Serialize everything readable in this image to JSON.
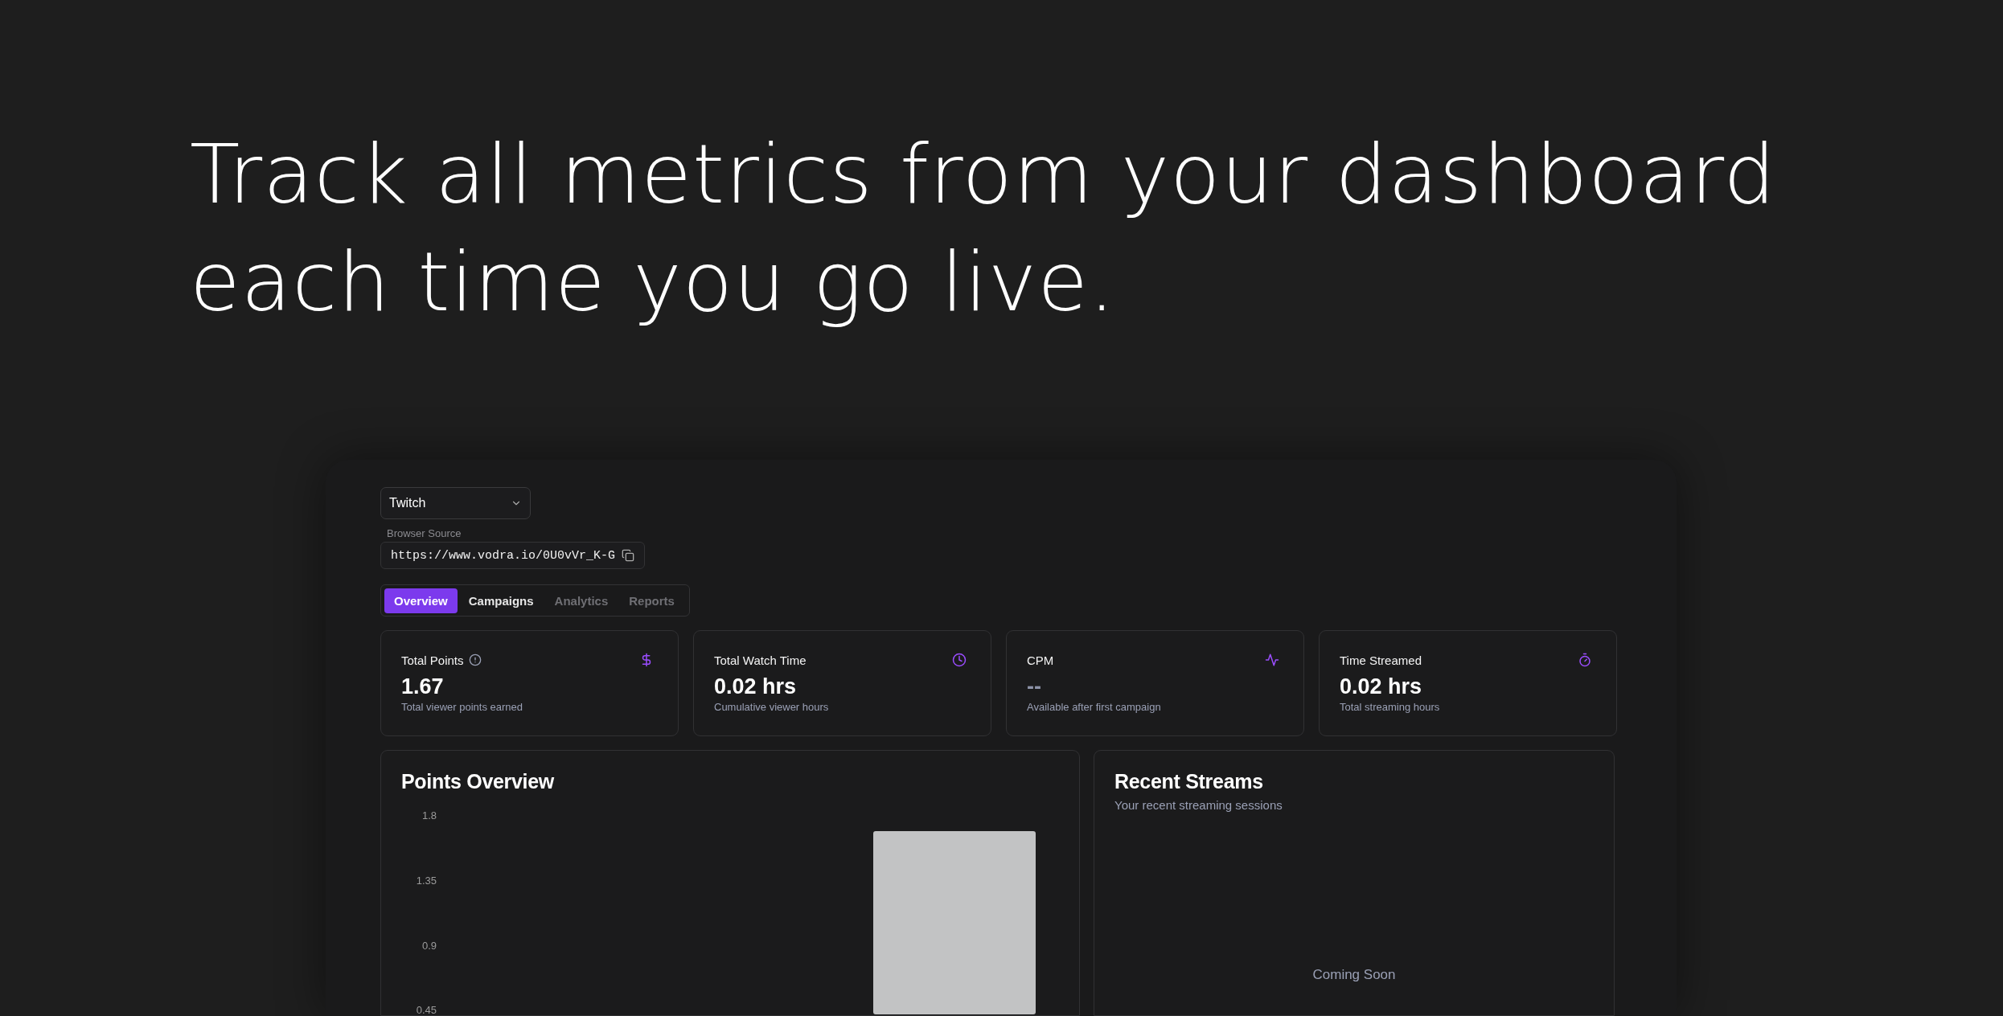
{
  "headline": {
    "lines": [
      "Track all metrics from your dashboard",
      "each time you go live."
    ]
  },
  "dashboard": {
    "platform_select": {
      "value": "Twitch"
    },
    "browser_source": {
      "label": "Browser Source",
      "value": "https://www.vodra.io/0U0vVr_K-G"
    },
    "tabs": [
      {
        "label": "Overview",
        "selected": true,
        "disabled": false
      },
      {
        "label": "Campaigns",
        "selected": false,
        "disabled": false
      },
      {
        "label": "Analytics",
        "selected": false,
        "disabled": true
      },
      {
        "label": "Reports",
        "selected": false,
        "disabled": true
      }
    ],
    "stats": [
      {
        "title": "Total Points",
        "info_icon": true,
        "value": "1.67",
        "muted": false,
        "caption": "Total viewer points earned"
      },
      {
        "title": "Total Watch Time",
        "info_icon": false,
        "value": "0.02 hrs",
        "muted": false,
        "caption": "Cumulative viewer hours"
      },
      {
        "title": "CPM",
        "info_icon": false,
        "value": "--",
        "muted": true,
        "caption": "Available after first campaign"
      },
      {
        "title": "Time Streamed",
        "info_icon": false,
        "value": "0.02 hrs",
        "muted": false,
        "caption": "Total streaming hours"
      }
    ],
    "points_overview": {
      "title": "Points Overview",
      "y_axis_labels": [
        "1.8",
        "1.35",
        "0.9",
        "0.45"
      ]
    },
    "recent_streams": {
      "title": "Recent Streams",
      "subtitle": "Your recent streaming sessions",
      "empty_text": "Coming Soon"
    }
  }
}
